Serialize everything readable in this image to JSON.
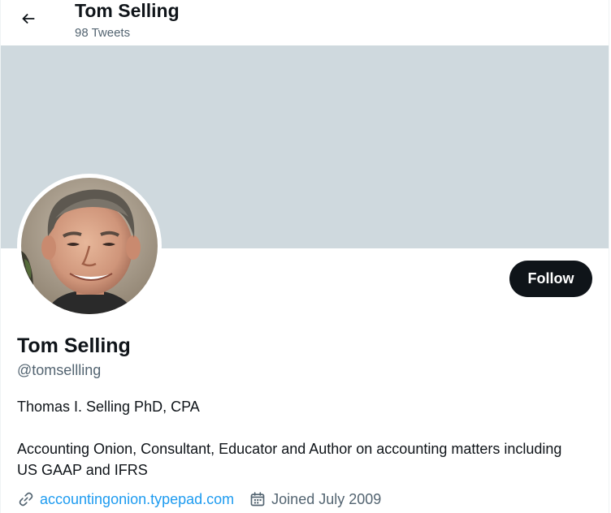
{
  "header": {
    "name": "Tom Selling",
    "tweet_count": "98 Tweets",
    "back_icon": "arrow-left-icon"
  },
  "banner": {
    "color": "#cfd9de"
  },
  "profile": {
    "avatar_alt": "Tom Selling",
    "follow_label": "Follow",
    "display_name": "Tom Selling",
    "handle": "@tomsellling",
    "bio_line1": "Thomas I. Selling PhD, CPA",
    "bio_line2": "Accounting Onion, Consultant, Educator and Author on accounting matters including US GAAP and IFRS",
    "website": "accountingonion.typepad.com",
    "joined": "Joined July 2009",
    "link_icon": "link-icon",
    "calendar_icon": "calendar-icon"
  },
  "colors": {
    "text_primary": "#0f1419",
    "text_secondary": "#536471",
    "link": "#1d9bf0",
    "follow_bg": "#0f1419",
    "follow_text": "#ffffff"
  }
}
